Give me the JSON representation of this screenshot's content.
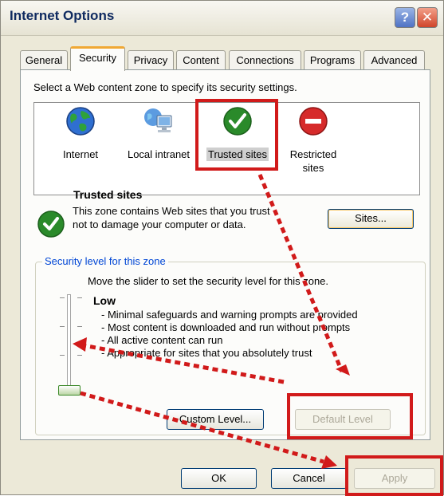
{
  "window": {
    "title": "Internet Options"
  },
  "tabs": [
    "General",
    "Security",
    "Privacy",
    "Content",
    "Connections",
    "Programs",
    "Advanced"
  ],
  "zones": {
    "instruction": "Select a Web content zone to specify its security settings.",
    "items": [
      {
        "label": "Internet",
        "icon": "globe-icon"
      },
      {
        "label": "Local intranet",
        "icon": "network-computer-icon"
      },
      {
        "label": "Trusted sites",
        "icon": "checkmark-icon",
        "selected": true
      },
      {
        "label": "Restricted sites",
        "icon": "no-entry-icon"
      }
    ]
  },
  "zone_info": {
    "title": "Trusted sites",
    "description": "This zone contains Web sites that you trust not to damage your computer or data.",
    "sites_button": "Sites..."
  },
  "security_level": {
    "group_title": "Security level for this zone",
    "slider_instruction": "Move the slider to set the security level for this zone.",
    "level_name": "Low",
    "level_points": [
      "- Minimal safeguards and warning prompts are provided",
      "- Most content is downloaded and run without prompts",
      "- All active content can run",
      "- Appropriate for sites that you absolutely trust"
    ],
    "custom_level_button": "Custom Level...",
    "default_level_button": "Default Level"
  },
  "dialog_buttons": {
    "ok": "OK",
    "cancel": "Cancel",
    "apply": "Apply"
  },
  "colors": {
    "highlight_red": "#d11a1a",
    "tab_accent": "#f0a834",
    "group_title": "#0046d5"
  }
}
